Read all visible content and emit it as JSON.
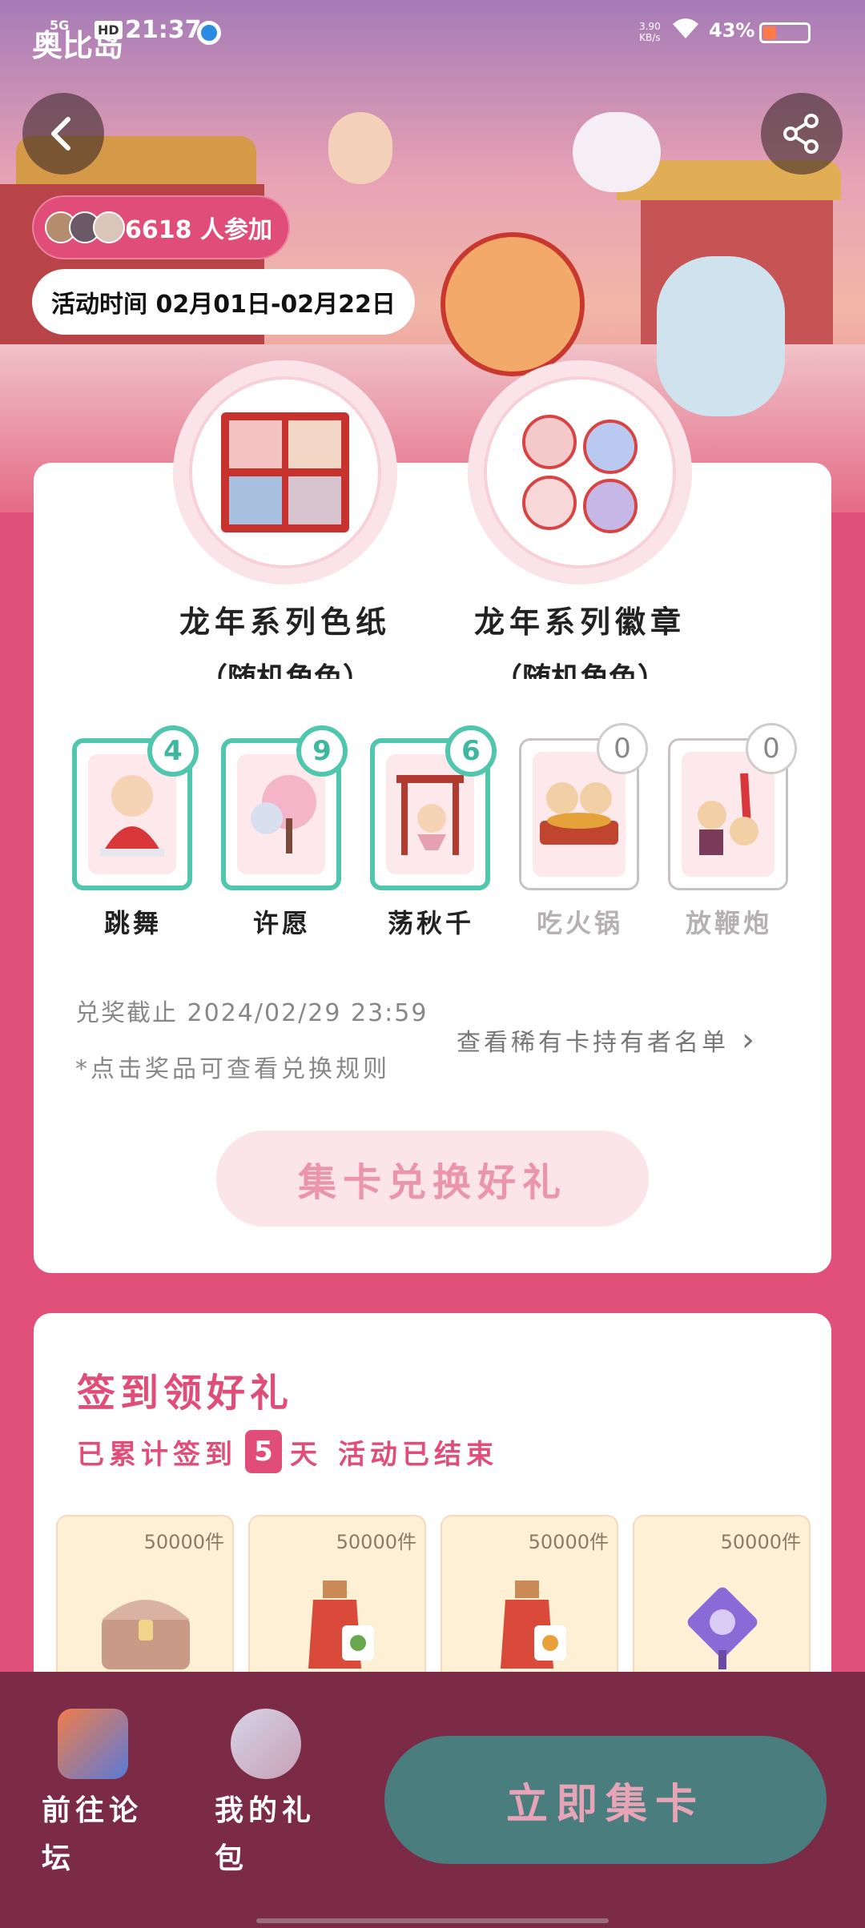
{
  "status_bar": {
    "logo": "奥比岛",
    "network": "5G",
    "hd": "HD",
    "time": "21:37",
    "speed_value": "3.90",
    "speed_unit": "KB/s",
    "battery": "43%"
  },
  "hero": {
    "participants": "6618 人参加",
    "activity_time": "活动时间 02月01日-02月22日"
  },
  "prizes": [
    {
      "name": "龙年系列色纸",
      "sub": "（随机角色）"
    },
    {
      "name": "龙年系列徽章",
      "sub": "（随机角色）"
    }
  ],
  "collect_cards": [
    {
      "label": "跳舞",
      "count": "4",
      "owned": true
    },
    {
      "label": "许愿",
      "count": "9",
      "owned": true
    },
    {
      "label": "荡秋千",
      "count": "6",
      "owned": true
    },
    {
      "label": "吃火锅",
      "count": "0",
      "owned": false
    },
    {
      "label": "放鞭炮",
      "count": "0",
      "owned": false
    }
  ],
  "redeem": {
    "deadline": "兑奖截止 2024/02/29 23:59",
    "tip": "*点击奖品可查看兑换规则",
    "holders_link": "查看稀有卡持有者名单",
    "button": "集卡兑换好礼"
  },
  "sign": {
    "title": "签到领好礼",
    "prefix": "已累计签到",
    "days": "5",
    "suffix": "天",
    "status": "活动已结束",
    "rewards": [
      {
        "qty": "50000件",
        "icon": "treasure-chest-icon"
      },
      {
        "qty": "50000件",
        "icon": "potion-bottle-icon"
      },
      {
        "qty": "50000件",
        "icon": "potion-bottle-icon"
      },
      {
        "qty": "50000件",
        "icon": "purple-item-icon"
      }
    ]
  },
  "bottom_bar": {
    "forum": "前往论坛",
    "gift": "我的礼包",
    "cta": "立即集卡"
  },
  "colors": {
    "accent": "#e04d79",
    "teal": "#4fc6ad",
    "cta": "#4a7d7e",
    "bottom": "#7c2b46"
  }
}
